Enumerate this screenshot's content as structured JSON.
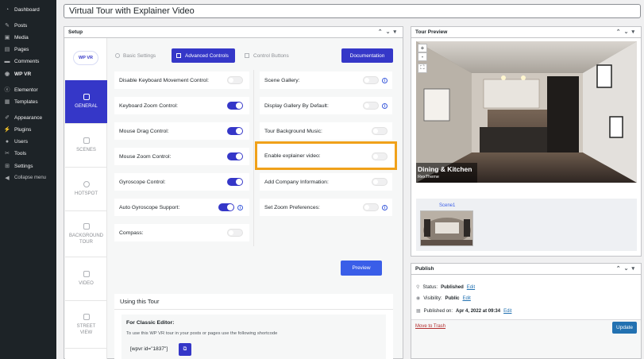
{
  "sidebar": {
    "items": [
      {
        "label": "Dashboard",
        "icon": "dashboard-icon"
      },
      {
        "label": "Posts",
        "icon": "pin-icon"
      },
      {
        "label": "Media",
        "icon": "media-icon"
      },
      {
        "label": "Pages",
        "icon": "pages-icon"
      },
      {
        "label": "Comments",
        "icon": "comments-icon"
      },
      {
        "label": "WP VR",
        "icon": "vr-icon"
      },
      {
        "label": "Elementor",
        "icon": "elementor-icon"
      },
      {
        "label": "Templates",
        "icon": "templates-icon"
      },
      {
        "label": "Appearance",
        "icon": "brush-icon"
      },
      {
        "label": "Plugins",
        "icon": "plugin-icon"
      },
      {
        "label": "Users",
        "icon": "users-icon"
      },
      {
        "label": "Tools",
        "icon": "wrench-icon"
      },
      {
        "label": "Settings",
        "icon": "settings-icon"
      },
      {
        "label": "Collapse menu",
        "icon": "collapse-icon"
      }
    ]
  },
  "post_title": "Virtual Tour with Explainer Video",
  "setup": {
    "title": "Setup",
    "logo_text": "WP VR",
    "nav": [
      {
        "label": "GENERAL"
      },
      {
        "label": "SCENES"
      },
      {
        "label": "HOTSPOT"
      },
      {
        "label": "BACKGROUND TOUR"
      },
      {
        "label": "VIDEO"
      },
      {
        "label": "STREET VIEW"
      }
    ],
    "tabs": {
      "basic": "Basic Settings",
      "advanced": "Advanced Controls",
      "control": "Control Buttons"
    },
    "documentation": "Documentation",
    "left_rows": [
      {
        "label": "Disable Keyboard Movement Control:",
        "on": false
      },
      {
        "label": "Keyboard Zoom Control:",
        "on": true
      },
      {
        "label": "Mouse Drag Control:",
        "on": true
      },
      {
        "label": "Mouse Zoom Control:",
        "on": true
      },
      {
        "label": "Gyroscope Control:",
        "on": true
      },
      {
        "label": "Auto Gyroscope Support:",
        "on": true
      },
      {
        "label": "Compass:",
        "on": false
      }
    ],
    "right_rows": [
      {
        "label": "Scene Gallery:",
        "on": false
      },
      {
        "label": "Display Gallery By Default:",
        "on": false
      },
      {
        "label": "Tour Background Music:",
        "on": false
      },
      {
        "label": "Enable explainer video:",
        "on": false
      },
      {
        "label": "Add Company Information:",
        "on": false
      },
      {
        "label": "Set Zoom Preferences:",
        "on": false
      }
    ],
    "preview_button": "Preview",
    "using": {
      "title": "Using this Tour",
      "subtitle": "For Classic Editor:",
      "description": "To use this WP VR tour in your posts or pages use the following shortcode",
      "shortcode": "[wpvr id=\"1837\"]"
    }
  },
  "tour_preview": {
    "title": "Tour Preview",
    "zoom_in": "+",
    "zoom_out": "-",
    "scene_label": "Dining & Kitchen",
    "scene_sublabel": "RexTheme",
    "scene_thumb_label": "Scene1"
  },
  "publish": {
    "title": "Publish",
    "status_label": "Status:",
    "status_value": "Published",
    "visibility_label": "Visibility:",
    "visibility_value": "Public",
    "published_label": "Published on:",
    "published_value": "Apr 4, 2022 at 09:34",
    "edit": "Edit",
    "trash": "Move to Trash",
    "update": "Update"
  },
  "colors": {
    "accent": "#3537c8",
    "highlight": "#f0a11a",
    "sidebar_bg": "#1d2327"
  }
}
